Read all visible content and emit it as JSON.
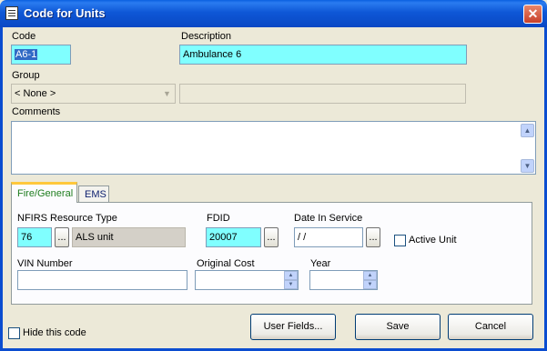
{
  "window": {
    "title": "Code for Units",
    "close_glyph": "✕",
    "icon": "document-icon"
  },
  "code": {
    "label": "Code",
    "value": "A6-1"
  },
  "description": {
    "label": "Description",
    "value": "Ambulance 6"
  },
  "group": {
    "label": "Group",
    "selected": "< None >",
    "extra_value": ""
  },
  "comments": {
    "label": "Comments",
    "value": ""
  },
  "tabs": [
    {
      "label": "Fire/General",
      "active": true
    },
    {
      "label": "EMS",
      "active": false
    }
  ],
  "fire_general": {
    "nfirs_label": "NFIRS Resource Type",
    "nfirs_code": "76",
    "nfirs_desc": "ALS unit",
    "fdid_label": "FDID",
    "fdid_value": "20007",
    "date_label": "Date In Service",
    "date_value": " / /",
    "active_unit_label": "Active Unit",
    "active_unit_checked": false,
    "vin_label": "VIN Number",
    "vin_value": "",
    "cost_label": "Original Cost",
    "cost_value": "",
    "year_label": "Year",
    "year_value": ""
  },
  "ellipsis_label": "...",
  "hide_code": {
    "label": "Hide this code",
    "checked": false
  },
  "buttons": {
    "user_fields": "User Fields...",
    "save": "Save",
    "cancel": "Cancel"
  },
  "colors": {
    "required_field": "#80ffff",
    "titlebar": "#0a5fe0",
    "tab_accent": "#ffc83c"
  }
}
